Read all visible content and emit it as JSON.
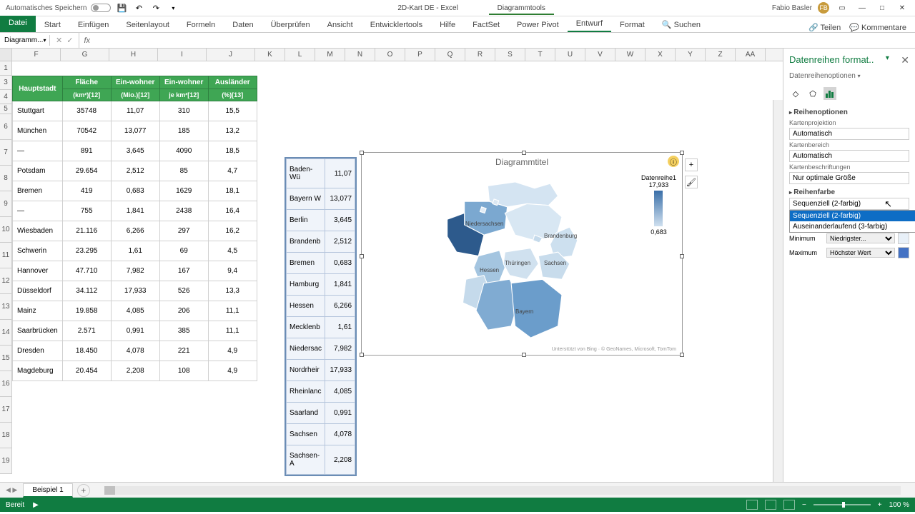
{
  "titlebar": {
    "autosave": "Automatisches Speichern",
    "filename": "2D-Kart DE - Excel",
    "context_tab": "Diagrammtools",
    "user": "Fabio Basler",
    "user_initials": "FB"
  },
  "ribbon": {
    "file": "Datei",
    "tabs": [
      "Start",
      "Einfügen",
      "Seitenlayout",
      "Formeln",
      "Daten",
      "Überprüfen",
      "Ansicht",
      "Entwicklertools",
      "Hilfe",
      "FactSet",
      "Power Pivot",
      "Entwurf",
      "Format"
    ],
    "search": "Suchen",
    "share": "Teilen",
    "comments": "Kommentare"
  },
  "namebox": "Diagramm...",
  "columns": [
    "F",
    "G",
    "H",
    "I",
    "J",
    "K",
    "L",
    "M",
    "N",
    "O",
    "P",
    "Q",
    "R",
    "S",
    "T",
    "U",
    "V",
    "W",
    "X",
    "Y",
    "Z",
    "AA"
  ],
  "table": {
    "headers": [
      {
        "main": "Hauptstadt",
        "sub": ""
      },
      {
        "main": "Fläche",
        "sub": "(km²)[12]"
      },
      {
        "main": "Ein-wohner",
        "sub": "(Mio.)[12]"
      },
      {
        "main": "Ein-wohner",
        "sub": "je km²[12]"
      },
      {
        "main": "Ausländer",
        "sub": "(%)[13]"
      }
    ],
    "rows": [
      [
        "Stuttgart",
        "35748",
        "11,07",
        "310",
        "15,5"
      ],
      [
        "München",
        "70542",
        "13,077",
        "185",
        "13,2"
      ],
      [
        "—",
        "891",
        "3,645",
        "4090",
        "18,5"
      ],
      [
        "Potsdam",
        "29.654",
        "2,512",
        "85",
        "4,7"
      ],
      [
        "Bremen",
        "419",
        "0,683",
        "1629",
        "18,1"
      ],
      [
        "—",
        "755",
        "1,841",
        "2438",
        "16,4"
      ],
      [
        "Wiesbaden",
        "21.116",
        "6,266",
        "297",
        "16,2"
      ],
      [
        "Schwerin",
        "23.295",
        "1,61",
        "69",
        "4,5"
      ],
      [
        "Hannover",
        "47.710",
        "7,982",
        "167",
        "9,4"
      ],
      [
        "Düsseldorf",
        "34.112",
        "17,933",
        "526",
        "13,3"
      ],
      [
        "Mainz",
        "19.858",
        "4,085",
        "206",
        "11,1"
      ],
      [
        "Saarbrücken",
        "2.571",
        "0,991",
        "385",
        "11,1"
      ],
      [
        "Dresden",
        "18.450",
        "4,078",
        "221",
        "4,9"
      ],
      [
        "Magdeburg",
        "20.454",
        "2,208",
        "108",
        "4,9"
      ]
    ]
  },
  "helper": [
    [
      "Baden-Wü",
      "11,07"
    ],
    [
      "Bayern W",
      "13,077"
    ],
    [
      "Berlin",
      "3,645"
    ],
    [
      "Brandenb",
      "2,512"
    ],
    [
      "Bremen",
      "0,683"
    ],
    [
      "Hamburg",
      "1,841"
    ],
    [
      "Hessen",
      "6,266"
    ],
    [
      "Mecklenb",
      "1,61"
    ],
    [
      "Niedersac",
      "7,982"
    ],
    [
      "Nordrheir",
      "17,933"
    ],
    [
      "Rheinlanc",
      "4,085"
    ],
    [
      "Saarland",
      "0,991"
    ],
    [
      "Sachsen",
      "4,078"
    ],
    [
      "Sachsen-A",
      "2,208"
    ]
  ],
  "chart": {
    "title": "Diagrammtitel",
    "legend_title": "Datenreihe1",
    "legend_max": "17,933",
    "legend_min": "0,683",
    "labels": [
      "Niedersachsen",
      "Brandenburg",
      "Thüringen",
      "Sachsen",
      "Hessen",
      "Bayern"
    ],
    "attribution": "Unterstützt von Bing · © GeoNames, Microsoft, TomTom"
  },
  "panel": {
    "title": "Datenreihen format..",
    "subtitle": "Datenreihenoptionen",
    "section1": "Reihenoptionen",
    "proj_label": "Kartenprojektion",
    "proj_value": "Automatisch",
    "area_label": "Kartenbereich",
    "area_value": "Automatisch",
    "labels_label": "Kartenbeschriftungen",
    "labels_value": "Nur optimale Größe",
    "section2": "Reihenfarbe",
    "color_sel": "Sequenziell (2-farbig)",
    "color_opts": [
      "Sequenziell (2-farbig)",
      "Auseinanderlaufend (3-farbig)"
    ],
    "min_label": "Minimum",
    "min_value": "Niedrigster...",
    "max_label": "Maximum",
    "max_value": "Höchster Wert"
  },
  "sheet_tab": "Beispiel 1",
  "status": "Bereit",
  "zoom": "100 %",
  "chart_data": {
    "type": "choropleth-map",
    "title": "Diagrammtitel",
    "region": "Germany states",
    "series_name": "Datenreihe1",
    "value_range": [
      0.683,
      17.933
    ],
    "data": [
      {
        "state": "Baden-Württemberg",
        "value": 11.07
      },
      {
        "state": "Bayern",
        "value": 13.077
      },
      {
        "state": "Berlin",
        "value": 3.645
      },
      {
        "state": "Brandenburg",
        "value": 2.512
      },
      {
        "state": "Bremen",
        "value": 0.683
      },
      {
        "state": "Hamburg",
        "value": 1.841
      },
      {
        "state": "Hessen",
        "value": 6.266
      },
      {
        "state": "Mecklenburg-Vorpommern",
        "value": 1.61
      },
      {
        "state": "Niedersachsen",
        "value": 7.982
      },
      {
        "state": "Nordrhein-Westfalen",
        "value": 17.933
      },
      {
        "state": "Rheinland-Pfalz",
        "value": 4.085
      },
      {
        "state": "Saarland",
        "value": 0.991
      },
      {
        "state": "Sachsen",
        "value": 4.078
      },
      {
        "state": "Sachsen-Anhalt",
        "value": 2.208
      }
    ]
  }
}
